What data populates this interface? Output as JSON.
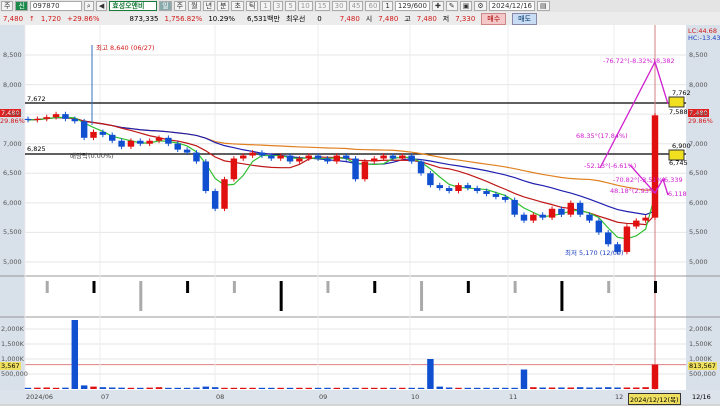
{
  "toolbar": {
    "period": "주",
    "code": "097870",
    "name": "효성오앤비",
    "tabs": [
      "일",
      "주",
      "월",
      "년",
      "분",
      "초",
      "틱"
    ],
    "intervals": [
      "1",
      "3",
      "5",
      "10",
      "15",
      "30",
      "45",
      "60"
    ],
    "count": "1",
    "range": "129/600",
    "date": "2024/12/16",
    "market_badge": "신"
  },
  "info": {
    "price": "7,480",
    "change": "1,720",
    "change_pct": "+29.86%",
    "volume": "873,335",
    "volume_pct": "1,756.82%",
    "turnover": "10.29%",
    "amount": "6,531백만",
    "pref_label": "최우선",
    "pref_value": "0",
    "price2": "7,480",
    "open_label": "시",
    "open": "7,480",
    "high_label": "고",
    "high": "7,480",
    "low_label": "저",
    "low": "7,330",
    "buy": "매수",
    "sell": "매도"
  },
  "price_axis": {
    "ticks": [
      "8,500",
      "8,000",
      "7,500",
      "7,000",
      "6,500",
      "6,000",
      "5,500",
      "5,000"
    ],
    "current": "7,480",
    "current_pct": "29.86%",
    "lc": "LC:44.68",
    "hc": "HC:-13.43"
  },
  "volume_axis": {
    "ticks": [
      "2,000K",
      "1,500K",
      "1,000K",
      "500,000"
    ],
    "current": "813,567",
    "current_left": "3,567"
  },
  "x_axis": {
    "labels": [
      "2024/06",
      "07",
      "08",
      "09",
      "10",
      "11",
      "12"
    ],
    "cursor": "2024/12/12(목)",
    "last": "12/16"
  },
  "annotations": {
    "high": "최고 8,640 (06/27)",
    "low": "최저 5,170 (12/09)",
    "dividend": "배당락(0.00%)",
    "line1": "7,672",
    "line2": "6,825",
    "box1_top": "7,762",
    "box1_bottom": "7,588",
    "box2_top": "6,900",
    "box2_bottom": "6,745",
    "a1": "-76.72°(-8.32%)",
    "a1v": "8,382",
    "a2": "68.35°(17.84%)",
    "a3": "-52.13°(-6.61%)",
    "a4": "-70.82°(-3.51%)",
    "a4v": "6,339",
    "a5": "48.18°(2.93%)",
    "a5v": "6,118"
  },
  "colors": {
    "up": "#e01010",
    "down": "#1050d0",
    "ma_long": "#e08020",
    "ma_mid": "#2020b0",
    "ma_short": "#c01818",
    "ma_fast": "#30c030",
    "annot": "#d020d0"
  },
  "chart_data": {
    "type": "candlestick",
    "ylim": [
      4900,
      8700
    ],
    "closes": [
      7400,
      7420,
      7450,
      7500,
      7420,
      7380,
      7100,
      7200,
      7150,
      7050,
      6950,
      7050,
      7000,
      7050,
      7100,
      7000,
      6900,
      6850,
      6700,
      6200,
      5900,
      6400,
      6750,
      6800,
      6850,
      6800,
      6750,
      6800,
      6700,
      6750,
      6800,
      6750,
      6700,
      6800,
      6750,
      6400,
      6700,
      6750,
      6800,
      6750,
      6800,
      6700,
      6500,
      6300,
      6250,
      6200,
      6300,
      6250,
      6200,
      6150,
      6100,
      6050,
      5800,
      5700,
      5800,
      5750,
      5900,
      5800,
      6000,
      5800,
      5700,
      5500,
      5300,
      5170,
      5600,
      5700,
      5750,
      7480
    ],
    "volumes_k": [
      40,
      45,
      50,
      40,
      45,
      2300,
      120,
      80,
      60,
      50,
      45,
      40,
      40,
      45,
      60,
      40,
      40,
      40,
      50,
      80,
      60,
      40,
      40,
      40,
      40,
      40,
      40,
      40,
      40,
      40,
      40,
      40,
      40,
      40,
      40,
      40,
      40,
      40,
      40,
      40,
      40,
      40,
      40,
      1000,
      80,
      50,
      40,
      40,
      40,
      40,
      40,
      40,
      40,
      650,
      60,
      50,
      50,
      50,
      50,
      60,
      50,
      50,
      60,
      50,
      50,
      50,
      60,
      813.567
    ]
  }
}
